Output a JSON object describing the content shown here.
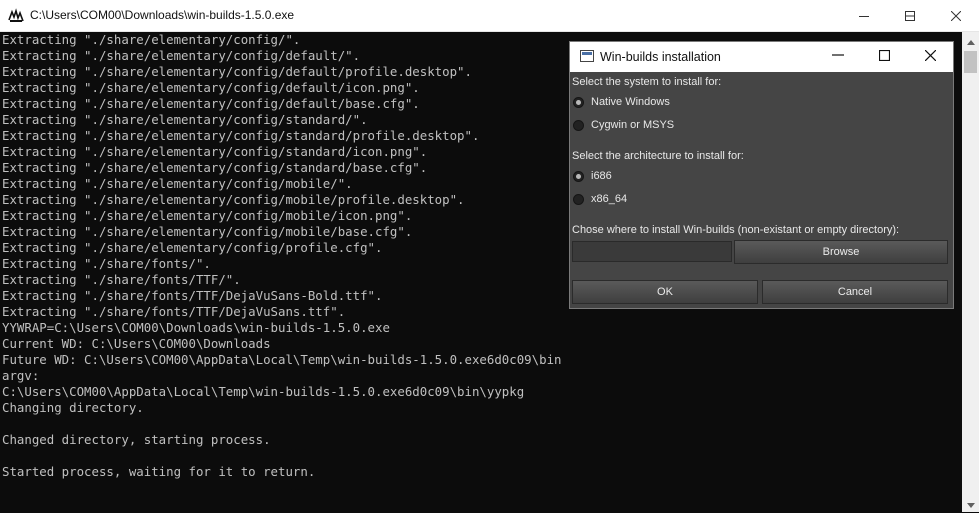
{
  "console_window": {
    "title": "C:\\Users\\COM00\\Downloads\\win-builds-1.5.0.exe",
    "app_icon": "cmd-icon",
    "controls": [
      "minimize-icon",
      "maximize-icon",
      "close-icon"
    ]
  },
  "console": {
    "lines": [
      "Extracting \"./share/elementary/config/\".",
      "Extracting \"./share/elementary/config/default/\".",
      "Extracting \"./share/elementary/config/default/profile.desktop\".",
      "Extracting \"./share/elementary/config/default/icon.png\".",
      "Extracting \"./share/elementary/config/default/base.cfg\".",
      "Extracting \"./share/elementary/config/standard/\".",
      "Extracting \"./share/elementary/config/standard/profile.desktop\".",
      "Extracting \"./share/elementary/config/standard/icon.png\".",
      "Extracting \"./share/elementary/config/standard/base.cfg\".",
      "Extracting \"./share/elementary/config/mobile/\".",
      "Extracting \"./share/elementary/config/mobile/profile.desktop\".",
      "Extracting \"./share/elementary/config/mobile/icon.png\".",
      "Extracting \"./share/elementary/config/mobile/base.cfg\".",
      "Extracting \"./share/elementary/config/profile.cfg\".",
      "Extracting \"./share/fonts/\".",
      "Extracting \"./share/fonts/TTF/\".",
      "Extracting \"./share/fonts/TTF/DejaVuSans-Bold.ttf\".",
      "Extracting \"./share/fonts/TTF/DejaVuSans.ttf\".",
      "YYWRAP=C:\\Users\\COM00\\Downloads\\win-builds-1.5.0.exe",
      "Current WD: C:\\Users\\COM00\\Downloads",
      "Future WD: C:\\Users\\COM00\\AppData\\Local\\Temp\\win-builds-1.5.0.exe6d0c09\\bin",
      "argv:",
      "C:\\Users\\COM00\\AppData\\Local\\Temp\\win-builds-1.5.0.exe6d0c09\\bin\\yypkg",
      "Changing directory.",
      "",
      "Changed directory, starting process.",
      "",
      "Started process, waiting for it to return."
    ]
  },
  "dialog": {
    "title": "Win-builds installation",
    "system_label": "Select the system to install for:",
    "system_options": [
      {
        "label": "Native Windows",
        "checked": true
      },
      {
        "label": "Cygwin or MSYS",
        "checked": false
      }
    ],
    "arch_label": "Select the architecture to install for:",
    "arch_options": [
      {
        "label": "i686",
        "checked": true
      },
      {
        "label": "x86_64",
        "checked": false
      }
    ],
    "dir_label": "Chose where to install Win-builds (non-existant or empty directory):",
    "dir_value": "",
    "browse_label": "Browse",
    "ok_label": "OK",
    "cancel_label": "Cancel"
  }
}
